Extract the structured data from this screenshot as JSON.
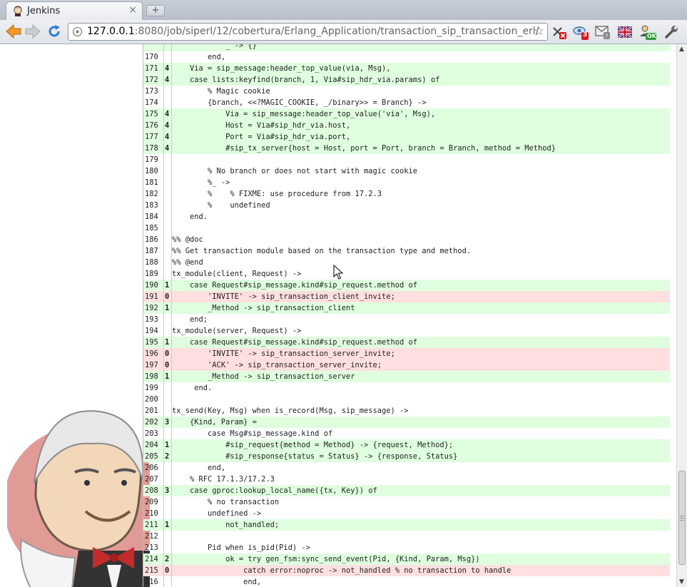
{
  "browser": {
    "tab_title": "Jenkins",
    "tab_close_glyph": "×",
    "new_tab_glyph": "+",
    "url_host": "127.0.0.1",
    "url_rest": ":8080/job/siperl/12/cobertura/Erlang_Application/transaction_sip_transaction_erl/",
    "bookmark_glyph": "☆",
    "extensions": [
      {
        "name": "x-red-badge-icon",
        "badge": ""
      },
      {
        "name": "eye-3-badge-icon",
        "badge": "3"
      },
      {
        "name": "mail-icon",
        "badge": ""
      },
      {
        "name": "uk-flag-icon",
        "badge": ""
      },
      {
        "name": "user-ok-badge-icon",
        "badge": "OK"
      },
      {
        "name": "wrench-icon",
        "badge": ""
      }
    ]
  },
  "colors": {
    "covered": "#dfffdf",
    "uncovered": "#ffdfdf",
    "toolbar": "#e6e9ed"
  },
  "source": {
    "lines": [
      {
        "n": "",
        "c": "",
        "s": "            _ -> {}",
        "st": "hit"
      },
      {
        "n": "170",
        "c": "",
        "s": "        end,",
        "st": ""
      },
      {
        "n": "171",
        "c": "4",
        "s": "    Via = sip_message:header_top_value(via, Msg),",
        "st": "hit"
      },
      {
        "n": "172",
        "c": "4",
        "s": "    case lists:keyfind(branch, 1, Via#sip_hdr_via.params) of",
        "st": "hit"
      },
      {
        "n": "173",
        "c": "",
        "s": "        % Magic cookie",
        "st": ""
      },
      {
        "n": "174",
        "c": "",
        "s": "        {branch, <<?MAGIC_COOKIE, _/binary>> = Branch} ->",
        "st": ""
      },
      {
        "n": "175",
        "c": "4",
        "s": "            Via = sip_message:header_top_value('via', Msg),",
        "st": "hit"
      },
      {
        "n": "176",
        "c": "4",
        "s": "            Host = Via#sip_hdr_via.host,",
        "st": "hit"
      },
      {
        "n": "177",
        "c": "4",
        "s": "            Port = Via#sip_hdr_via.port,",
        "st": "hit"
      },
      {
        "n": "178",
        "c": "4",
        "s": "            #sip_tx_server{host = Host, port = Port, branch = Branch, method = Method}",
        "st": "hit"
      },
      {
        "n": "179",
        "c": "",
        "s": "",
        "st": ""
      },
      {
        "n": "180",
        "c": "",
        "s": "        % No branch or does not start with magic cookie",
        "st": ""
      },
      {
        "n": "181",
        "c": "",
        "s": "        %_ ->",
        "st": ""
      },
      {
        "n": "182",
        "c": "",
        "s": "        %    % FIXME: use procedure from 17.2.3",
        "st": ""
      },
      {
        "n": "183",
        "c": "",
        "s": "        %    undefined",
        "st": ""
      },
      {
        "n": "184",
        "c": "",
        "s": "    end.",
        "st": ""
      },
      {
        "n": "185",
        "c": "",
        "s": "",
        "st": ""
      },
      {
        "n": "186",
        "c": "",
        "s": "%% @doc",
        "st": ""
      },
      {
        "n": "187",
        "c": "",
        "s": "%% Get transaction module based on the transaction type and method.",
        "st": ""
      },
      {
        "n": "188",
        "c": "",
        "s": "%% @end",
        "st": ""
      },
      {
        "n": "189",
        "c": "",
        "s": "tx_module(client, Request) ->",
        "st": ""
      },
      {
        "n": "190",
        "c": "1",
        "s": "    case Request#sip_message.kind#sip_request.method of",
        "st": "hit"
      },
      {
        "n": "191",
        "c": "0",
        "s": "        'INVITE' -> sip_transaction_client_invite;",
        "st": "miss"
      },
      {
        "n": "192",
        "c": "1",
        "s": "        _Method -> sip_transaction_client",
        "st": "hit"
      },
      {
        "n": "193",
        "c": "",
        "s": "    end;",
        "st": ""
      },
      {
        "n": "194",
        "c": "",
        "s": "tx_module(server, Request) ->",
        "st": ""
      },
      {
        "n": "195",
        "c": "1",
        "s": "    case Request#sip_message.kind#sip_request.method of",
        "st": "hit"
      },
      {
        "n": "196",
        "c": "0",
        "s": "        'INVITE' -> sip_transaction_server_invite;",
        "st": "miss"
      },
      {
        "n": "197",
        "c": "0",
        "s": "        'ACK' -> sip_transaction_server_invite;",
        "st": "miss"
      },
      {
        "n": "198",
        "c": "1",
        "s": "        _Method -> sip_transaction_server",
        "st": "hit"
      },
      {
        "n": "199",
        "c": "",
        "s": "     end.",
        "st": ""
      },
      {
        "n": "200",
        "c": "",
        "s": "",
        "st": ""
      },
      {
        "n": "201",
        "c": "",
        "s": "tx_send(Key, Msg) when is_record(Msg, sip_message) ->",
        "st": ""
      },
      {
        "n": "202",
        "c": "3",
        "s": "    {Kind, Param} =",
        "st": "hit"
      },
      {
        "n": "203",
        "c": "",
        "s": "        case Msg#sip_message.kind of",
        "st": ""
      },
      {
        "n": "204",
        "c": "1",
        "s": "            #sip_request{method = Method} -> {request, Method};",
        "st": "hit"
      },
      {
        "n": "205",
        "c": "2",
        "s": "            #sip_response{status = Status} -> {response, Status}",
        "st": "hit"
      },
      {
        "n": "206",
        "c": "",
        "s": "        end,",
        "st": ""
      },
      {
        "n": "207",
        "c": "",
        "s": "    % RFC 17.1.3/17.2.3",
        "st": ""
      },
      {
        "n": "208",
        "c": "3",
        "s": "    case gproc:lookup_local_name({tx, Key}) of",
        "st": "hit"
      },
      {
        "n": "209",
        "c": "",
        "s": "        % no transaction",
        "st": ""
      },
      {
        "n": "210",
        "c": "",
        "s": "        undefined ->",
        "st": ""
      },
      {
        "n": "211",
        "c": "1",
        "s": "            not_handled;",
        "st": "hit"
      },
      {
        "n": "212",
        "c": "",
        "s": "",
        "st": ""
      },
      {
        "n": "213",
        "c": "",
        "s": "        Pid when is_pid(Pid) ->",
        "st": ""
      },
      {
        "n": "214",
        "c": "2",
        "s": "            ok = try gen_fsm:sync_send_event(Pid, {Kind, Param, Msg})",
        "st": "hit"
      },
      {
        "n": "215",
        "c": "0",
        "s": "                catch error:noproc -> not_handled % no transaction to handle",
        "st": "miss"
      },
      {
        "n": "216",
        "c": "",
        "s": "                end,",
        "st": ""
      }
    ]
  }
}
